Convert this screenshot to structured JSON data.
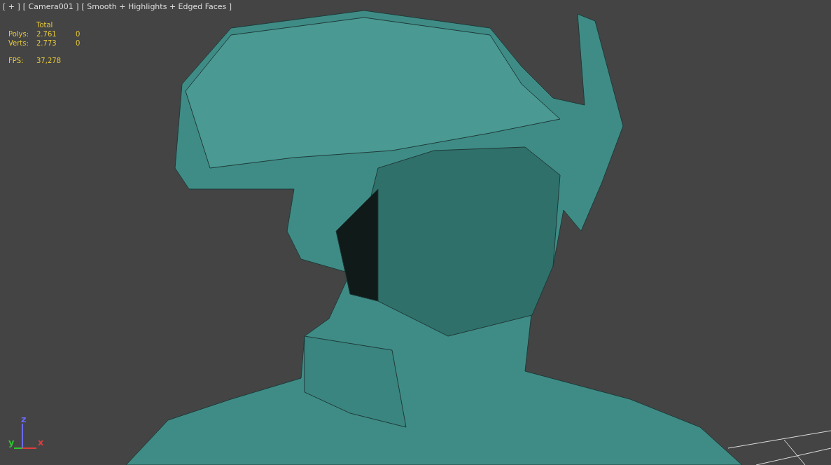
{
  "viewport": {
    "labels": [
      "[ + ]",
      "[ Camera001 ]",
      "[ Smooth + Highlights + Edged Faces ]"
    ]
  },
  "statistics": {
    "header": "Total",
    "rows": [
      {
        "label": "Polys:",
        "total": "2.761",
        "selected": "0"
      },
      {
        "label": "Verts:",
        "total": "2.773",
        "selected": "0"
      }
    ],
    "fps": {
      "label": "FPS:",
      "value": "37,278"
    }
  },
  "axis_gizmo": {
    "axes": [
      {
        "label": "z",
        "color": "#6a6aff"
      },
      {
        "label": "y",
        "color": "#2ec82e"
      },
      {
        "label": "x",
        "color": "#e03c3c"
      }
    ]
  }
}
